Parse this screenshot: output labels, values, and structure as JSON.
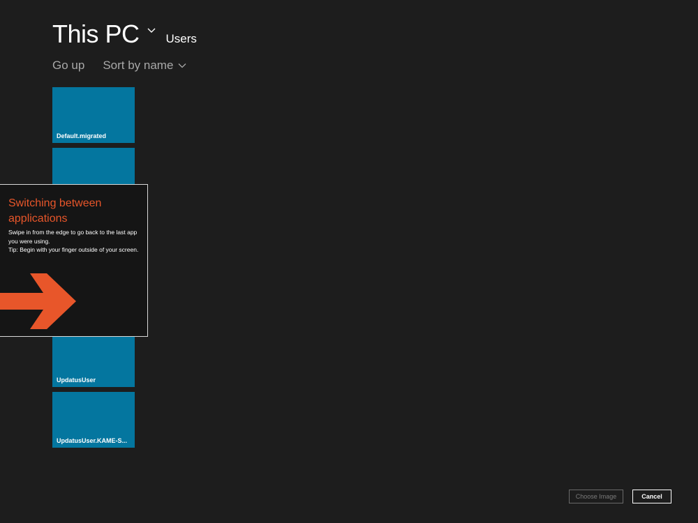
{
  "header": {
    "location": "This PC",
    "folder": "Users",
    "location_menu_icon": "chevron-down-icon"
  },
  "commands": {
    "go_up": "Go up",
    "sort": "Sort by name",
    "sort_menu_icon": "chevron-down-icon"
  },
  "folders": [
    {
      "name": "Default.migrated"
    },
    {
      "name": ""
    },
    {
      "name": "UpdatusUser"
    },
    {
      "name": "UpdatusUser.KAME-S..."
    }
  ],
  "tip": {
    "title": "Switching between applications",
    "line1": "Swipe in from the edge to go back to the last app you were using.",
    "line2": "Tip: Begin with your finger outside of your screen.",
    "icon": "arrow-right-icon",
    "accent_color": "#e8562a"
  },
  "footer": {
    "choose_label": "Choose Image",
    "cancel_label": "Cancel"
  },
  "colors": {
    "background": "#1d1d1d",
    "tile": "#04769f",
    "tip_background": "#151515"
  }
}
